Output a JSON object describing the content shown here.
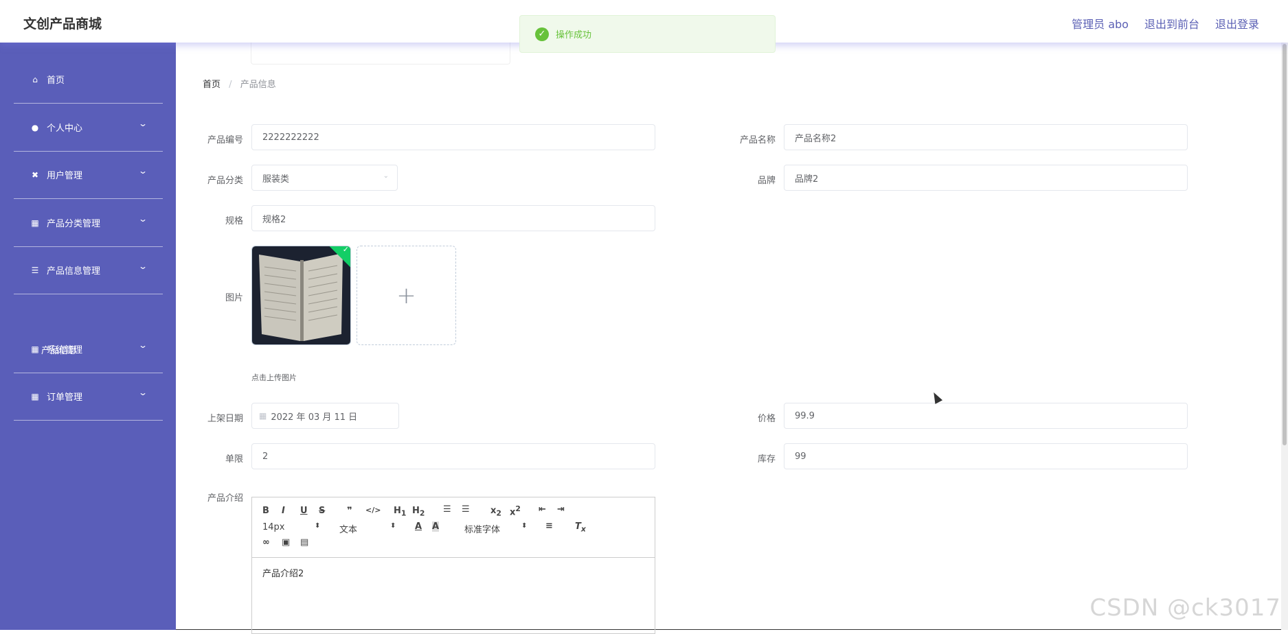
{
  "header": {
    "brand": "文创产品商城",
    "admin": "管理员 abo",
    "to_front": "退出到前台",
    "logout": "退出登录"
  },
  "toast": {
    "message": "操作成功"
  },
  "sidebar": {
    "items": [
      {
        "label": "首页",
        "icon": "home-icon"
      },
      {
        "label": "个人中心",
        "icon": "user-icon"
      },
      {
        "label": "用户管理",
        "icon": "users-icon"
      },
      {
        "label": "产品分类管理",
        "icon": "grid-icon"
      },
      {
        "label": "产品信息管理",
        "icon": "list-icon"
      },
      {
        "label": "系统管理",
        "icon": "grid-icon"
      },
      {
        "label": "订单管理",
        "icon": "grid-icon"
      }
    ],
    "submenu_label": "产品信息"
  },
  "breadcrumb": {
    "home": "首页",
    "sep": "/",
    "current": "产品信息"
  },
  "form": {
    "product_no_label": "产品编号",
    "product_no": "2222222222",
    "product_name_label": "产品名称",
    "product_name": "产品名称2",
    "category_label": "产品分类",
    "category": "服装类",
    "brand_label": "品牌",
    "brand": "品牌2",
    "spec_label": "规格",
    "spec": "规格2",
    "image_label": "图片",
    "upload_tip": "点击上传图片",
    "date_label": "上架日期",
    "date": "2022 年 03 月 11 日",
    "price_label": "价格",
    "price": "99.9",
    "limit_label": "单限",
    "limit": "2",
    "stock_label": "库存",
    "stock": "99",
    "intro_label": "产品介绍",
    "intro": "产品介绍2"
  },
  "editor": {
    "font_size": "14px",
    "heading": "文本",
    "font_family": "标准字体"
  },
  "watermark": "CSDN @ck3017"
}
